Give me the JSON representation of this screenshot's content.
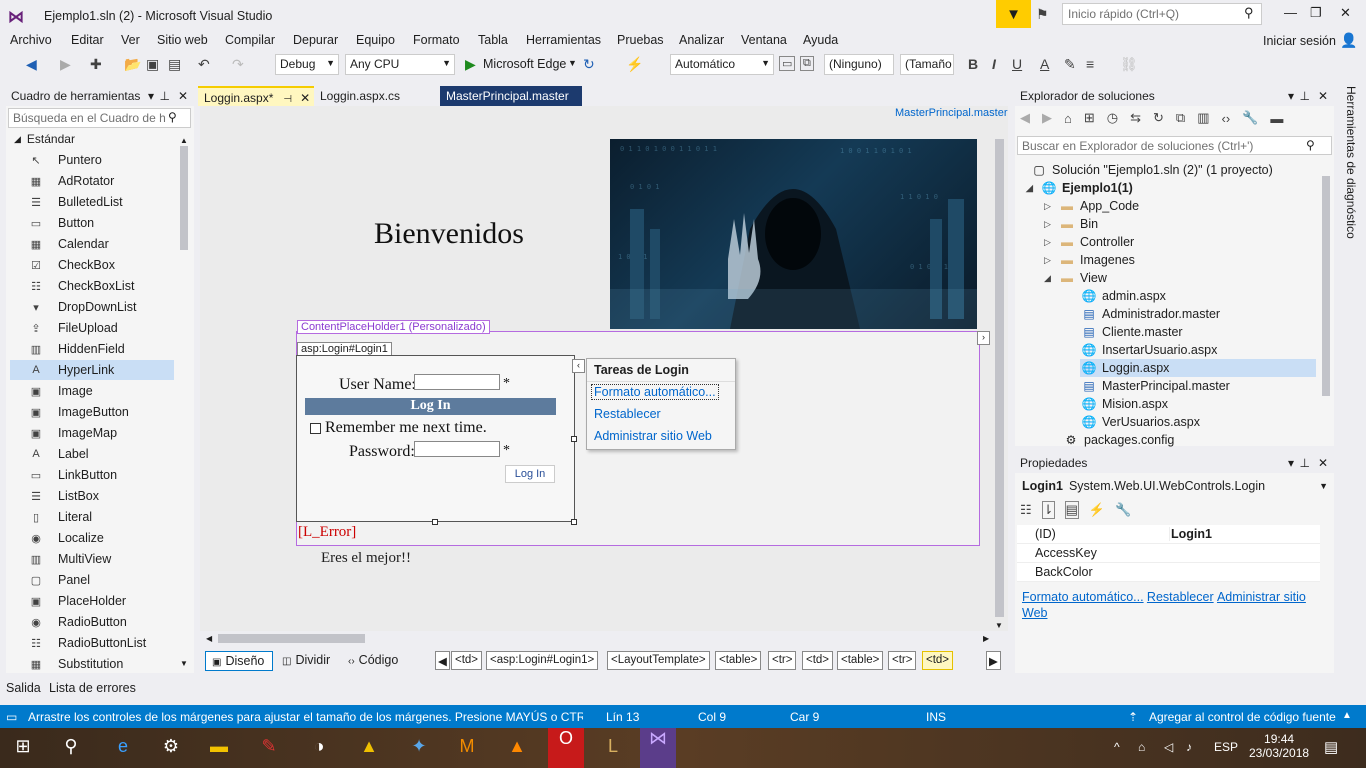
{
  "window": {
    "title": "Ejemplo1.sln (2) - Microsoft Visual Studio",
    "quick_launch_placeholder": "Inicio rápido (Ctrl+Q)"
  },
  "menu": [
    "Archivo",
    "Editar",
    "Ver",
    "Sitio web",
    "Compilar",
    "Depurar",
    "Equipo",
    "Formato",
    "Tabla",
    "Herramientas",
    "Pruebas",
    "Analizar",
    "Ventana",
    "Ayuda"
  ],
  "signin": "Iniciar sesión",
  "toolbar": {
    "config": "Debug",
    "platform": "Any CPU",
    "run_target": "Microsoft Edge",
    "position": "Automático",
    "style": "(Ninguno)",
    "size": "(Tamaño",
    "bold": "B",
    "italic": "I",
    "underline": "U",
    "fontcolor": "A"
  },
  "toolbox": {
    "title": "Cuadro de herramientas",
    "search_placeholder": "Búsqueda en el Cuadro de h",
    "section": "Estándar",
    "items": [
      "Puntero",
      "AdRotator",
      "BulletedList",
      "Button",
      "Calendar",
      "CheckBox",
      "CheckBoxList",
      "DropDownList",
      "FileUpload",
      "HiddenField",
      "HyperLink",
      "Image",
      "ImageButton",
      "ImageMap",
      "Label",
      "LinkButton",
      "ListBox",
      "Literal",
      "Localize",
      "MultiView",
      "Panel",
      "PlaceHolder",
      "RadioButton",
      "RadioButtonList",
      "Substitution"
    ]
  },
  "editor": {
    "tabs": [
      "Loggin.aspx*",
      "Loggin.aspx.cs",
      "MasterPrincipal.master"
    ],
    "master_link": "MasterPrincipal.master",
    "welcome": "Bienvenidos",
    "cph_label": "ContentPlaceHolder1 (Personalizado)",
    "login_label": "asp:Login#Login1",
    "user_label": "User Name:",
    "login_header": "Log In",
    "remember": "Remember me next time.",
    "password_label": "Password:",
    "required": "*",
    "login_button": "Log In",
    "error_label": "[L_Error]",
    "eres": "Eres el mejor!!",
    "tasks_title": "Tareas de Login",
    "tasks": [
      "Formato automático...",
      "Restablecer",
      "Administrar sitio Web"
    ]
  },
  "viewbar": {
    "views": [
      "Diseño",
      "Dividir",
      "Código"
    ],
    "crumbs": [
      "<td>",
      "<asp:Login#Login1>",
      "<LayoutTemplate>",
      "<table>",
      "<tr>",
      "<td>",
      "<table>",
      "<tr>",
      "<td>"
    ]
  },
  "solution": {
    "title": "Explorador de soluciones",
    "search_placeholder": "Buscar en Explorador de soluciones (Ctrl+')",
    "root": "Solución \"Ejemplo1.sln (2)\"  (1 proyecto)",
    "project": "Ejemplo1(1)",
    "folders": [
      "App_Code",
      "Bin",
      "Controller",
      "Imagenes",
      "View"
    ],
    "view_files": [
      "admin.aspx",
      "Administrador.master",
      "Cliente.master",
      "InsertarUsuario.aspx",
      "Loggin.aspx",
      "MasterPrincipal.master",
      "Mision.aspx",
      "VerUsuarios.aspx"
    ],
    "extra": "packages.config"
  },
  "properties": {
    "title": "Propiedades",
    "object": "Login1",
    "type": "System.Web.UI.WebControls.Login",
    "rows": [
      {
        "key": "(ID)",
        "value": "Login1"
      },
      {
        "key": "AccessKey",
        "value": ""
      },
      {
        "key": "BackColor",
        "value": ""
      }
    ],
    "links": [
      "Formato automático...",
      "Restablecer",
      "Administrar sitio Web"
    ]
  },
  "diagnostics_strip": "Herramientas de diagnóstico",
  "output_tabs": [
    "Salida",
    "Lista de errores"
  ],
  "status": {
    "message": "Arrastre los controles de los márgenes para ajustar el tamaño de los márgenes. Presione MAYÚS o CTRL...",
    "line": "Lín 13",
    "col": "Col 9",
    "char": "Car 9",
    "mode": "INS",
    "source_control": "Agregar al control de código fuente"
  },
  "taskbar": {
    "time": "19:44",
    "date": "23/03/2018",
    "lang": "ESP"
  },
  "colors": {
    "accent": "#007acc",
    "login_bar": "#5d7b9d",
    "cph_border": "#b56be0",
    "error": "#cc0000"
  }
}
